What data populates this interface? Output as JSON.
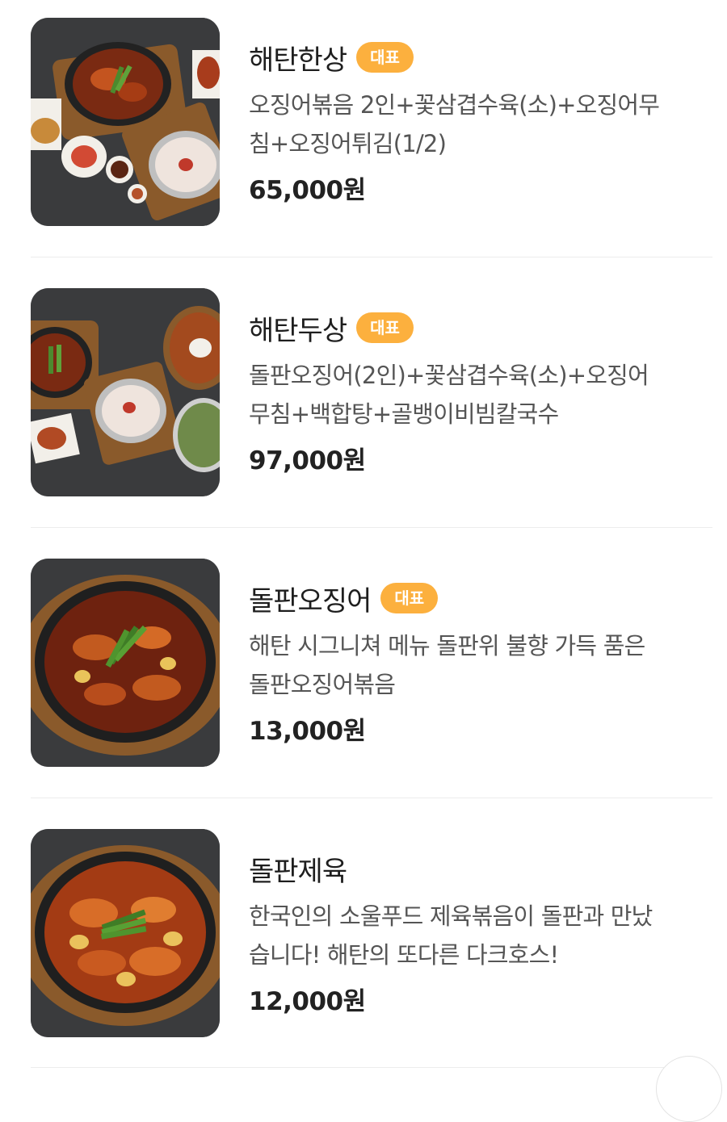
{
  "items": [
    {
      "name": "해탄한상",
      "badge": "대표",
      "desc_line1": "오징어볶음 2인+꽃삼겹수육(소)+오징어무",
      "desc_line2": "침+오징어튀김(1/2)",
      "price": "65,000",
      "currency": "원",
      "image": "set-meal-photo"
    },
    {
      "name": "해탄두상",
      "badge": "대표",
      "desc_line1": "돌판오징어(2인)+꽃삼겹수육(소)+오징어",
      "desc_line2": "무침+백합탕+골뱅이비빔칼국수",
      "price": "97,000",
      "currency": "원",
      "image": "set-meal-photo"
    },
    {
      "name": "돌판오징어",
      "badge": "대표",
      "desc_line1": "해탄 시그니쳐 메뉴 돌판위 불향 가득 품은",
      "desc_line2": "돌판오징어볶음",
      "price": "13,000",
      "currency": "원",
      "image": "stir-fried-squid-photo"
    },
    {
      "name": "돌판제육",
      "badge": "",
      "desc_line1": "한국인의 소울푸드 제육볶음이 돌판과 만났",
      "desc_line2": "습니다! 해탄의 또다른 다크호스!",
      "price": "12,000",
      "currency": "원",
      "image": "stir-fried-pork-photo"
    }
  ],
  "colors": {
    "badge_bg": "#fcb03e",
    "badge_text": "#ffffff",
    "photo_bg": "#3a3b3d",
    "divider": "#ececec"
  }
}
